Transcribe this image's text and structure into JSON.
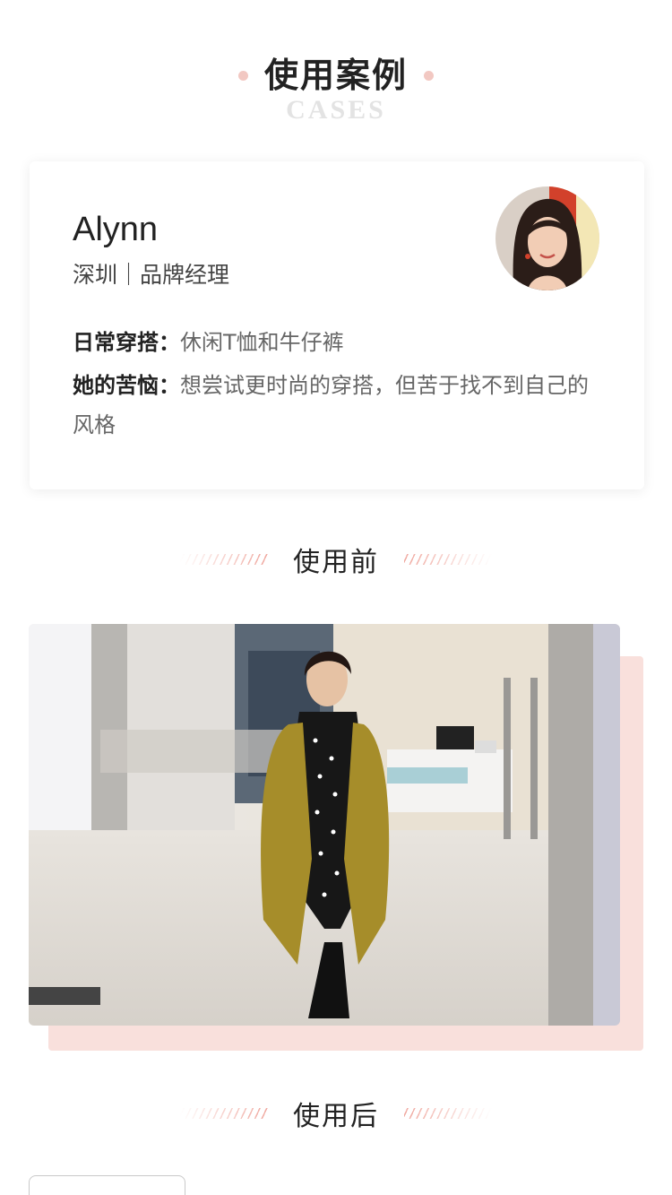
{
  "header": {
    "title": "使用案例",
    "subtitle": "CASES"
  },
  "profile": {
    "name": "Alynn",
    "meta": "深圳｜品牌经理",
    "daily_label": "日常穿搭：",
    "daily_value": "休闲T恤和牛仔裤",
    "trouble_label": "她的苦恼：",
    "trouble_value": "想尝试更时尚的穿搭，但苦于找不到自己的风格"
  },
  "sections": {
    "before_title": "使用前",
    "after_title": "使用后"
  },
  "colors": {
    "accent_pink": "#f2c8c2",
    "photo_shadow": "#f9e0dc",
    "coat": "#a68d2a"
  }
}
